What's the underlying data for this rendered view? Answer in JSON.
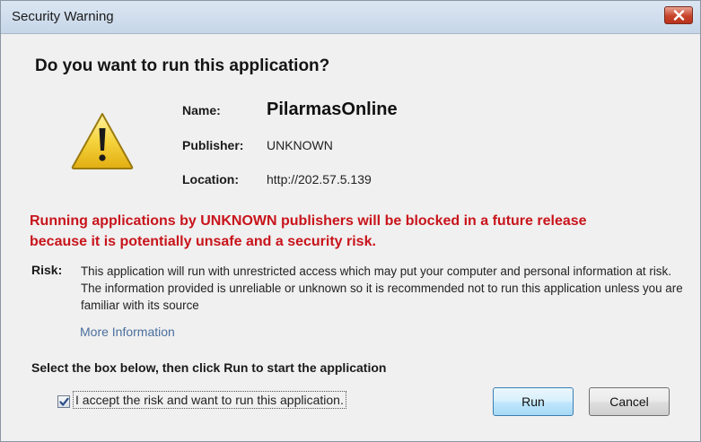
{
  "window": {
    "title": "Security Warning"
  },
  "dialog": {
    "headline": "Do you want to run this application?",
    "fields": {
      "name_label": "Name:",
      "name_value": "PilarmasOnline",
      "publisher_label": "Publisher:",
      "publisher_value": "UNKNOWN",
      "location_label": "Location:",
      "location_value": "http://202.57.5.139"
    },
    "warning": {
      "line1": "Running applications by UNKNOWN publishers will be blocked in a future release",
      "line2": "because it is potentially unsafe and a security risk."
    },
    "risk": {
      "label": "Risk:",
      "text": "This application will run with unrestricted access which may put your computer and personal information at risk. The information provided is unreliable or unknown so it is recommended not to run this application unless you are familiar with its source"
    },
    "more_info_link": "More Information",
    "instruction": "Select the box below, then click Run to start the application",
    "checkbox": {
      "label": "I accept the risk and want to run this application.",
      "checked": true
    },
    "buttons": {
      "run": "Run",
      "cancel": "Cancel"
    }
  },
  "icons": {
    "close": "close-icon",
    "warning": "warning-triangle-icon",
    "check": "checkmark-icon"
  },
  "colors": {
    "warning_text": "#c8141b",
    "link": "#4b6f9e",
    "titlebar": "#c6d6e8",
    "close_button": "#c7432a",
    "warning_icon_fill": "#f5d33d"
  }
}
